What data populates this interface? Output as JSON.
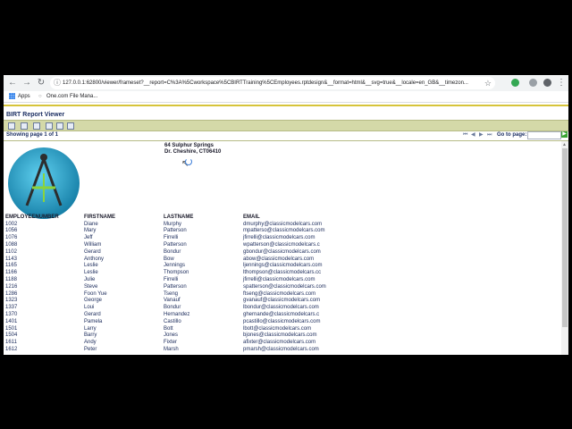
{
  "browser": {
    "url": "127.0.0.1:62800/viewer/frameset?__report=C%3A%5Cworkspace%5CBIRTTraining%5CEmployees.rptdesign&__format=html&__svg=true&__locale=en_GB&__timezon...",
    "bookmarks": [
      {
        "label": "Apps",
        "icon": "apps-grid-icon"
      },
      {
        "label": "One.com File Mana...",
        "icon": "one-com-icon"
      }
    ]
  },
  "viewer": {
    "title": "BIRT Report Viewer",
    "showing_page": "Showing page  1  of  1",
    "goto_label": "Go to page:",
    "goto_value": "",
    "accent_color": "#d4d9a8"
  },
  "report": {
    "address_line1": "64 Sulphur Springs",
    "address_line2": "Dr. Cheshire, CT06410",
    "columns": [
      "EMPLOYEENUMBER",
      "FIRSTNAME",
      "LASTNAME",
      "EMAIL"
    ],
    "rows": [
      [
        "1002",
        "Diane",
        "Murphy",
        "dmurphy@classicmodelcars.com"
      ],
      [
        "1056",
        "Mary",
        "Patterson",
        "mpatterso@classicmodelcars.com"
      ],
      [
        "1076",
        "Jeff",
        "Firrelli",
        "jfirrelli@classicmodelcars.com"
      ],
      [
        "1088",
        "William",
        "Patterson",
        "wpatterson@classicmodelcars.c"
      ],
      [
        "1102",
        "Gerard",
        "Bondur",
        "gbondur@classicmodelcars.com"
      ],
      [
        "1143",
        "Anthony",
        "Bow",
        "abow@classicmodelcars.com"
      ],
      [
        "1165",
        "Leslie",
        "Jennings",
        "ljennings@classicmodelcars.com"
      ],
      [
        "1166",
        "Leslie",
        "Thompson",
        "lthompson@classicmodelcars.cc"
      ],
      [
        "1188",
        "Julie",
        "Firrelli",
        "jfirrelli@classicmodelcars.com"
      ],
      [
        "1216",
        "Steve",
        "Patterson",
        "spatterson@classicmodelcars.com"
      ],
      [
        "1286",
        "Foon Yue",
        "Tseng",
        "ftseng@classicmodelcars.com"
      ],
      [
        "1323",
        "George",
        "Vanauf",
        "gvanauf@classicmodelcars.com"
      ],
      [
        "1337",
        "Loui",
        "Bondur",
        "lbondur@classicmodelcars.com"
      ],
      [
        "1370",
        "Gerard",
        "Hernandez",
        "ghernande@classicmodelcars.c"
      ],
      [
        "1401",
        "Pamela",
        "Castillo",
        "pcastillo@classicmodelcars.com"
      ],
      [
        "1501",
        "Larry",
        "Bott",
        "lbott@classicmodelcars.com"
      ],
      [
        "1504",
        "Barry",
        "Jones",
        "bjones@classicmodelcars.com"
      ],
      [
        "1611",
        "Andy",
        "Fixter",
        "afixter@classicmodelcars.com"
      ],
      [
        "1612",
        "Peter",
        "Marsh",
        "pmarsh@classicmodelcars.com"
      ]
    ]
  }
}
